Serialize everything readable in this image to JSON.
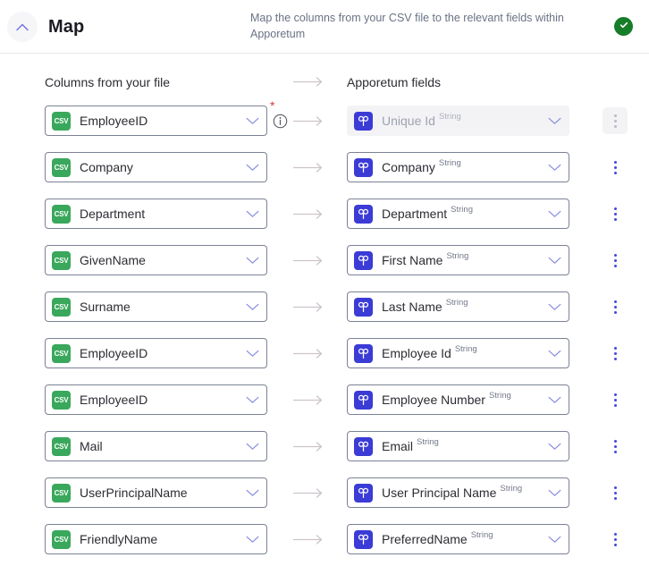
{
  "header": {
    "title": "Map",
    "description": "Map the columns from your CSV file to the relevant fields within Apporetum",
    "collapse_icon": "chevron-up-icon",
    "status_icon": "check-circle-icon",
    "status_color": "#167d28"
  },
  "columns": {
    "left_heading": "Columns from your file",
    "right_heading": "Apporetum fields",
    "arrow_icon": "arrow-right-icon"
  },
  "icons": {
    "csv_label": "CSV",
    "csv_color": "#3aa85c",
    "app_color": "#3b3bd6",
    "app_icon": "apporetum-clover-icon",
    "chevron_icon": "chevron-down-icon",
    "info_icon": "info-circle-icon",
    "required_marker": "*",
    "kebab_icon": "more-vertical-icon"
  },
  "rows": [
    {
      "source": "EmployeeID",
      "target": "Unique Id",
      "target_type": "String",
      "required": true,
      "target_disabled": true,
      "menu_disabled": true
    },
    {
      "source": "Company",
      "target": "Company",
      "target_type": "String",
      "required": false,
      "target_disabled": false,
      "menu_disabled": false
    },
    {
      "source": "Department",
      "target": "Department",
      "target_type": "String",
      "required": false,
      "target_disabled": false,
      "menu_disabled": false
    },
    {
      "source": "GivenName",
      "target": "First Name",
      "target_type": "String",
      "required": false,
      "target_disabled": false,
      "menu_disabled": false
    },
    {
      "source": "Surname",
      "target": "Last Name",
      "target_type": "String",
      "required": false,
      "target_disabled": false,
      "menu_disabled": false
    },
    {
      "source": "EmployeeID",
      "target": "Employee Id",
      "target_type": "String",
      "required": false,
      "target_disabled": false,
      "menu_disabled": false
    },
    {
      "source": "EmployeeID",
      "target": "Employee Number",
      "target_type": "String",
      "required": false,
      "target_disabled": false,
      "menu_disabled": false
    },
    {
      "source": "Mail",
      "target": "Email",
      "target_type": "String",
      "required": false,
      "target_disabled": false,
      "menu_disabled": false
    },
    {
      "source": "UserPrincipalName",
      "target": "User Principal Name",
      "target_type": "String",
      "required": false,
      "target_disabled": false,
      "menu_disabled": false
    },
    {
      "source": "FriendlyName",
      "target": "PreferredName",
      "target_type": "String",
      "required": false,
      "target_disabled": false,
      "menu_disabled": false
    }
  ]
}
